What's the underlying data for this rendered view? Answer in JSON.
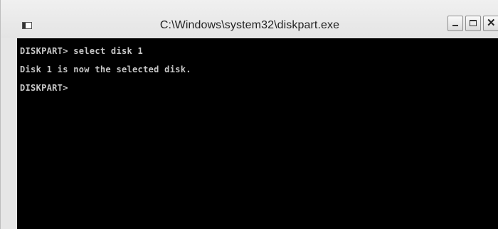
{
  "window": {
    "title": "C:\\Windows\\system32\\diskpart.exe",
    "controls": {
      "minimize": "minimize-icon",
      "maximize": "maximize-icon",
      "close": "close-icon"
    }
  },
  "console": {
    "lines": [
      "DISKPART> select disk 1",
      "Disk 1 is now the selected disk.",
      "DISKPART>"
    ]
  }
}
